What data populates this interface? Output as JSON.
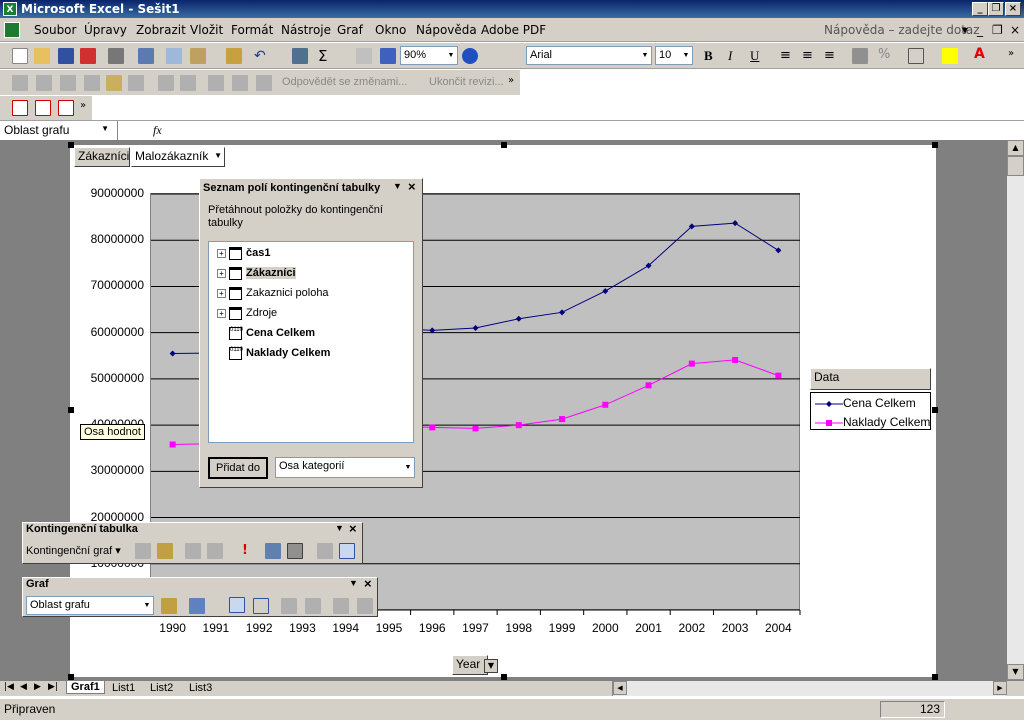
{
  "app": {
    "title": "Microsoft Excel - Sešit1"
  },
  "menu": [
    "Soubor",
    "Úpravy",
    "Zobrazit",
    "Vložit",
    "Formát",
    "Nástroje",
    "Graf",
    "Okno",
    "Nápověda",
    "Adobe PDF"
  ],
  "help_box": {
    "placeholder": "Nápověda – zadejte dotaz"
  },
  "toolbar": {
    "zoom": "90%",
    "font": "Arial",
    "size": "10",
    "bold": "B",
    "italic": "I",
    "underline": "U"
  },
  "review_bar": {
    "reply": "Odpovědět se změnami...",
    "end_review": "Ukončit revizi..."
  },
  "namebox": {
    "value": "Oblast grafu",
    "fx": "fx"
  },
  "chart": {
    "page_field_label": "Zákazníci",
    "page_field_value": "Malozákazník",
    "category_field": "Year",
    "legend_title": "Data",
    "axis_tooltip": "Osa hodnot"
  },
  "chart_data": {
    "type": "line",
    "categories": [
      "1990",
      "1991",
      "1992",
      "1993",
      "1994",
      "1995",
      "1996",
      "1997",
      "1998",
      "1999",
      "2000",
      "2001",
      "2002",
      "2003",
      "2004"
    ],
    "series": [
      {
        "name": "Cena Celkem",
        "color": "#00007f",
        "marker": "diamond",
        "values": [
          55500000,
          55600000,
          56500000,
          57600000,
          58800000,
          61000000,
          60500000,
          61000000,
          63000000,
          64400000,
          69000000,
          74500000,
          83000000,
          83700000,
          77800000
        ]
      },
      {
        "name": "Naklady Celkem",
        "color": "#ff00ff",
        "marker": "square",
        "values": [
          35800000,
          36000000,
          37000000,
          37700000,
          38600000,
          39800000,
          39500000,
          39300000,
          40000000,
          41300000,
          44400000,
          48600000,
          53300000,
          54100000,
          50700000
        ]
      }
    ],
    "yticks": [
      "10000000",
      "20000000",
      "30000000",
      "40000000",
      "50000000",
      "60000000",
      "70000000",
      "80000000",
      "90000000"
    ],
    "ylim": [
      0,
      90000000
    ],
    "grid": true,
    "legend_position": "right"
  },
  "fieldlist": {
    "title": "Seznam polí kontingenční tabulky",
    "hint": "Přetáhnout položky do kontingenční tabulky",
    "items": [
      {
        "label": "čas1",
        "bold": true,
        "expand": true,
        "icon": "table-icon"
      },
      {
        "label": "Zákazníci",
        "bold": true,
        "expand": true,
        "icon": "table-icon"
      },
      {
        "label": "Zakaznici poloha",
        "bold": false,
        "expand": true,
        "icon": "table-icon"
      },
      {
        "label": "Zdroje",
        "bold": false,
        "expand": true,
        "icon": "table-icon"
      },
      {
        "label": "Cena Celkem",
        "bold": true,
        "expand": false,
        "icon": "measure-icon"
      },
      {
        "label": "Naklady Celkem",
        "bold": true,
        "expand": false,
        "icon": "measure-icon"
      }
    ],
    "add_button": "Přidat do",
    "target": "Osa kategorií"
  },
  "pivot_toolbar": {
    "title": "Kontingenční tabulka",
    "menu": "Kontingenční graf"
  },
  "chart_toolbar": {
    "title": "Graf",
    "object": "Oblast grafu"
  },
  "sheets": [
    "Graf1",
    "List1",
    "List2",
    "List3"
  ],
  "status": {
    "text": "Připraven",
    "num": "123"
  }
}
